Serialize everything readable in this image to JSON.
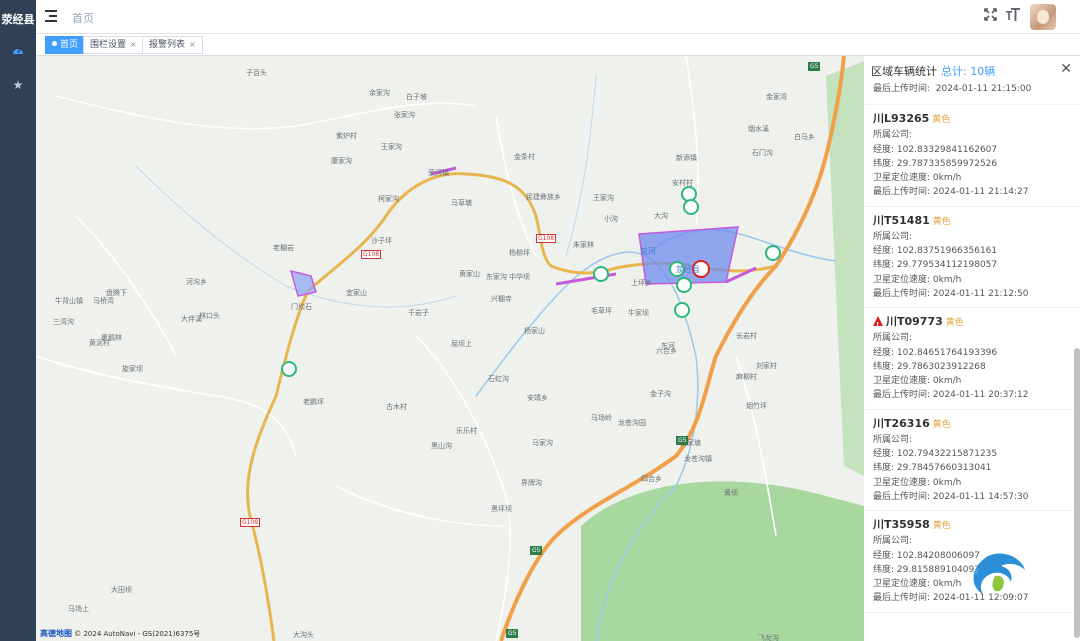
{
  "sidebar": {
    "brand": "荥经县"
  },
  "header": {
    "breadcrumb": "首页"
  },
  "tags": [
    {
      "label": "首页",
      "active": true
    },
    {
      "label": "围栏设置",
      "active": false
    },
    {
      "label": "报警列表",
      "active": false
    }
  ],
  "map": {
    "copyright_brand": "高德地图",
    "copyright_text": "© 2024 AutoNavi - GS(2021)6375号",
    "labels": [
      "子百头",
      "余家沟",
      "白子坡",
      "张家沟",
      "紫炉村",
      "王家沟",
      "康家沟",
      "金条村",
      "民建彝族乡",
      "马草塘",
      "柯家沟",
      "荥河镇",
      "沙子坪",
      "老棚岩",
      "东家沟",
      "黄家山",
      "中华坝",
      "杨柳坪",
      "河沟乡",
      "林口头",
      "马桥湾",
      "牛背山镇",
      "大伴溪",
      "三湾沟",
      "门坎石",
      "黄泥村",
      "宜家山",
      "千岩子",
      "兴棚寺",
      "毛草坪",
      "旋家坝",
      "屈坝上",
      "石虹沟",
      "杨家山",
      "老鹏坪",
      "安靖乡",
      "裹鹅林",
      "古木村",
      "马家沟",
      "黑山沟",
      "乐乐村",
      "界牌沟",
      "黑坪坝",
      "新添镇",
      "安村村",
      "大沟",
      "小沟",
      "朱家林",
      "王家沟",
      "牛家坝",
      "上坪乡",
      "六合乡",
      "长岩村",
      "荥河",
      "荥经县",
      "龙苍沟镇",
      "黄坝",
      "四合乡",
      "东河",
      "金子沟",
      "大田坝",
      "马场上",
      "大沟头",
      "盘腾下",
      "烟水溪",
      "石门沟",
      "白马乡",
      "金家湾",
      "飞龙沟",
      "龙苍沟园",
      "王家塘",
      "麻柳村",
      "刘家村",
      "烟竹坪",
      "马场岭"
    ],
    "road_labels": [
      "G108",
      "G108",
      "G108",
      "G5",
      "G5",
      "G5",
      "G5"
    ]
  },
  "panel": {
    "title": "区域车辆统计",
    "total_label": "总计:",
    "total_value": "10辆",
    "first_time_label": "最后上传时间:",
    "first_time_value": "2024-01-11 21:15:00",
    "field_labels": {
      "company": "所属公司:",
      "lng": "经度:",
      "lat": "纬度:",
      "speed": "卫星定位速度:",
      "time": "最后上传时间:"
    },
    "vehicles": [
      {
        "plate": "川L93265",
        "color": "黄色",
        "alert": false,
        "company": "",
        "lng": "102.83329841162607",
        "lat": "29.787335859972526",
        "speed": "0km/h",
        "time": "2024-01-11 21:14:27"
      },
      {
        "plate": "川T51481",
        "color": "黄色",
        "alert": false,
        "company": "",
        "lng": "102.83751966356161",
        "lat": "29.779534112198057",
        "speed": "0km/h",
        "time": "2024-01-11 21:12:50"
      },
      {
        "plate": "川T09773",
        "color": "黄色",
        "alert": true,
        "company": "",
        "lng": "102.84651764193396",
        "lat": "29.7863023912268",
        "speed": "0km/h",
        "time": "2024-01-11 20:37:12"
      },
      {
        "plate": "川T26316",
        "color": "黄色",
        "alert": false,
        "company": "",
        "lng": "102.79432215871235",
        "lat": "29.78457660313041",
        "speed": "0km/h",
        "time": "2024-01-11 14:57:30"
      },
      {
        "plate": "川T35958",
        "color": "黄色",
        "alert": false,
        "company": "",
        "lng": "102.84208006097",
        "lat": "29.8158891040934",
        "speed": "0km/h",
        "time": "2024-01-11 12:09:07"
      }
    ]
  },
  "colors": {
    "accent": "#409eff",
    "sidebar": "#304156",
    "highway": "#f0a04b",
    "plate_color": "#e6a23c",
    "fence": "#6f8cf0"
  }
}
